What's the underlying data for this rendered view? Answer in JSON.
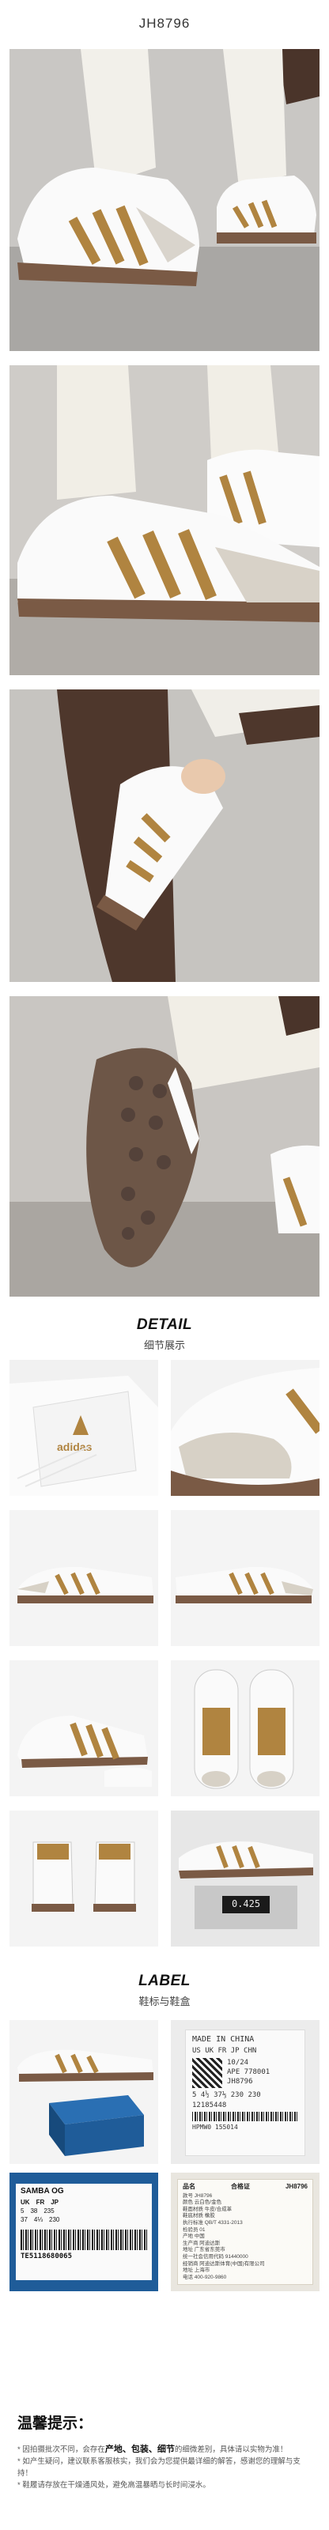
{
  "product_code": "JH8796",
  "detail_section": {
    "title_en": "DETAIL",
    "title_cn": "细节展示"
  },
  "label_section": {
    "title_en": "LABEL",
    "title_cn": "鞋标与鞋盒"
  },
  "box_label": {
    "brand_tag": "SAMBA OG",
    "sizes_head": [
      "UK",
      "FR",
      "JP"
    ],
    "sizes_row1": [
      "5",
      "38",
      "235"
    ],
    "sizes_row2": [
      "37",
      "4⅓",
      "230"
    ],
    "barcode": "TE5118680065"
  },
  "tongue_label": {
    "made_in": "MADE IN CHINA",
    "size_head": "US UK FR JP CHN",
    "size_values": "5  4½ 37⅓ 230 230",
    "date": "10/24",
    "ape": "APE 778001",
    "model": "JH8796",
    "code1": "12185448",
    "code2": "HPMW0 155014"
  },
  "certificate": {
    "left_title": "品名",
    "right_title": "合格证",
    "code": "JH8796",
    "lines": [
      "款号 JH8796",
      "颜色 云白色/金色",
      "鞋面材质 牛皮/合成革",
      "鞋底材质 橡胶",
      "执行标准 QB/T 4331-2013",
      "检验员 01",
      "产地 中国",
      "生产商 阿迪达斯",
      "地址 广东省东莞市",
      "统一社会信用代码 91440000",
      "经销商 阿迪达斯体育(中国)有限公司",
      "地址 上海市",
      "电话 400-920-9860"
    ]
  },
  "scale_readout": "0.425",
  "tips": {
    "title": "温馨提示：",
    "line1_pre": "* 因拍摄批次不同，会存在",
    "line1_bold": "产地、包装、细节",
    "line1_post": "的细微差别，具体请以实物为准！",
    "line2": "* 如产生疑问，建议联系客服核实，我们会为您提供最详细的解答，感谢您的理解与支持！",
    "line3": "* 鞋履请存放在干燥通风处，避免高温暴晒与长时间浸水。"
  }
}
